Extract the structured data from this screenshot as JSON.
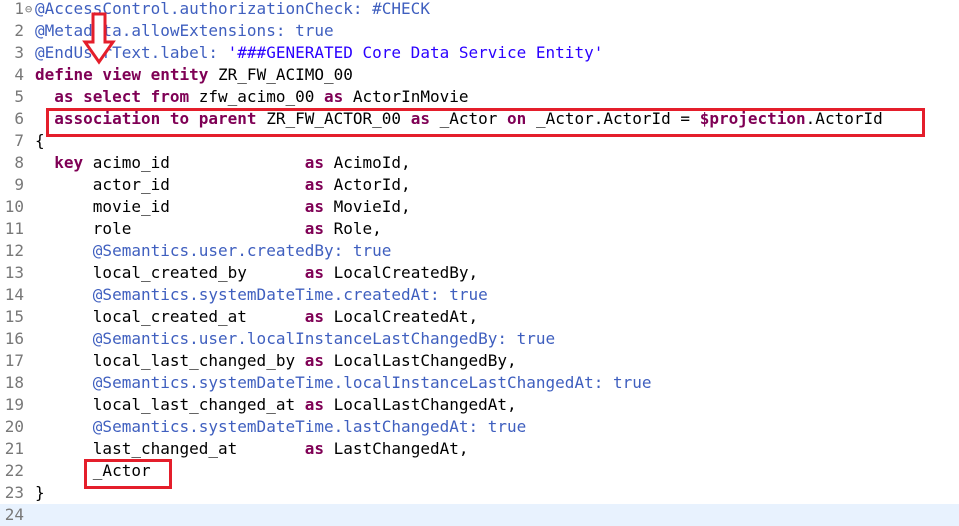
{
  "lines": [
    {
      "n": "1",
      "fold": "⊖",
      "tokens": [
        {
          "t": "ann",
          "v": "@AccessControl.authorizationCheck: #CHECK"
        }
      ]
    },
    {
      "n": "2",
      "fold": "",
      "tokens": [
        {
          "t": "ann",
          "v": "@Metadata.allowExtensions: true"
        }
      ]
    },
    {
      "n": "3",
      "fold": "",
      "tokens": [
        {
          "t": "ann",
          "v": "@EndUserText.label: "
        },
        {
          "t": "str",
          "v": "'###GENERATED Core Data Service Entity'"
        }
      ]
    },
    {
      "n": "4",
      "fold": "",
      "tokens": [
        {
          "t": "kw",
          "v": "define view entity "
        },
        {
          "t": "txt",
          "v": "ZR_FW_ACIMO_00"
        }
      ]
    },
    {
      "n": "5",
      "fold": "",
      "tokens": [
        {
          "t": "txt",
          "v": "  "
        },
        {
          "t": "kw",
          "v": "as select from "
        },
        {
          "t": "txt",
          "v": "zfw_acimo_00 "
        },
        {
          "t": "kw",
          "v": "as "
        },
        {
          "t": "txt",
          "v": "ActorInMovie"
        }
      ]
    },
    {
      "n": "6",
      "fold": "",
      "tokens": [
        {
          "t": "txt",
          "v": "  "
        },
        {
          "t": "kw",
          "v": "association to parent "
        },
        {
          "t": "txt",
          "v": "ZR_FW_ACTOR_00 "
        },
        {
          "t": "kw",
          "v": "as "
        },
        {
          "t": "txt",
          "v": "_Actor "
        },
        {
          "t": "kw",
          "v": "on "
        },
        {
          "t": "txt",
          "v": "_Actor.ActorId = "
        },
        {
          "t": "kw",
          "v": "$projection"
        },
        {
          "t": "txt",
          "v": ".ActorId"
        }
      ]
    },
    {
      "n": "7",
      "fold": "",
      "tokens": [
        {
          "t": "txt",
          "v": "{"
        }
      ]
    },
    {
      "n": "8",
      "fold": "",
      "tokens": [
        {
          "t": "txt",
          "v": "  "
        },
        {
          "t": "kw",
          "v": "key "
        },
        {
          "t": "txt",
          "v": "acimo_id              "
        },
        {
          "t": "kw",
          "v": "as "
        },
        {
          "t": "txt",
          "v": "AcimoId,"
        }
      ]
    },
    {
      "n": "9",
      "fold": "",
      "tokens": [
        {
          "t": "txt",
          "v": "      actor_id              "
        },
        {
          "t": "kw",
          "v": "as "
        },
        {
          "t": "txt",
          "v": "ActorId,"
        }
      ]
    },
    {
      "n": "10",
      "fold": "",
      "tokens": [
        {
          "t": "txt",
          "v": "      movie_id              "
        },
        {
          "t": "kw",
          "v": "as "
        },
        {
          "t": "txt",
          "v": "MovieId,"
        }
      ]
    },
    {
      "n": "11",
      "fold": "",
      "tokens": [
        {
          "t": "txt",
          "v": "      role                  "
        },
        {
          "t": "kw",
          "v": "as "
        },
        {
          "t": "txt",
          "v": "Role,"
        }
      ]
    },
    {
      "n": "12",
      "fold": "",
      "tokens": [
        {
          "t": "txt",
          "v": "      "
        },
        {
          "t": "ann",
          "v": "@Semantics.user.createdBy: true"
        }
      ]
    },
    {
      "n": "13",
      "fold": "",
      "tokens": [
        {
          "t": "txt",
          "v": "      local_created_by      "
        },
        {
          "t": "kw",
          "v": "as "
        },
        {
          "t": "txt",
          "v": "LocalCreatedBy,"
        }
      ]
    },
    {
      "n": "14",
      "fold": "",
      "tokens": [
        {
          "t": "txt",
          "v": "      "
        },
        {
          "t": "ann",
          "v": "@Semantics.systemDateTime.createdAt: true"
        }
      ]
    },
    {
      "n": "15",
      "fold": "",
      "tokens": [
        {
          "t": "txt",
          "v": "      local_created_at      "
        },
        {
          "t": "kw",
          "v": "as "
        },
        {
          "t": "txt",
          "v": "LocalCreatedAt,"
        }
      ]
    },
    {
      "n": "16",
      "fold": "",
      "tokens": [
        {
          "t": "txt",
          "v": "      "
        },
        {
          "t": "ann",
          "v": "@Semantics.user.localInstanceLastChangedBy: true"
        }
      ]
    },
    {
      "n": "17",
      "fold": "",
      "tokens": [
        {
          "t": "txt",
          "v": "      local_last_changed_by "
        },
        {
          "t": "kw",
          "v": "as "
        },
        {
          "t": "txt",
          "v": "LocalLastChangedBy,"
        }
      ]
    },
    {
      "n": "18",
      "fold": "",
      "tokens": [
        {
          "t": "txt",
          "v": "      "
        },
        {
          "t": "ann",
          "v": "@Semantics.systemDateTime.localInstanceLastChangedAt: true"
        }
      ]
    },
    {
      "n": "19",
      "fold": "",
      "tokens": [
        {
          "t": "txt",
          "v": "      local_last_changed_at "
        },
        {
          "t": "kw",
          "v": "as "
        },
        {
          "t": "txt",
          "v": "LocalLastChangedAt,"
        }
      ]
    },
    {
      "n": "20",
      "fold": "",
      "tokens": [
        {
          "t": "txt",
          "v": "      "
        },
        {
          "t": "ann",
          "v": "@Semantics.systemDateTime.lastChangedAt: true"
        }
      ]
    },
    {
      "n": "21",
      "fold": "",
      "tokens": [
        {
          "t": "txt",
          "v": "      last_changed_at       "
        },
        {
          "t": "kw",
          "v": "as "
        },
        {
          "t": "txt",
          "v": "LastChangedAt,"
        }
      ]
    },
    {
      "n": "22",
      "fold": "",
      "tokens": [
        {
          "t": "txt",
          "v": "      _Actor"
        }
      ]
    },
    {
      "n": "23",
      "fold": "",
      "tokens": [
        {
          "t": "txt",
          "v": "}"
        }
      ]
    },
    {
      "n": "24",
      "fold": "",
      "tokens": []
    }
  ],
  "colors": {
    "annotation": "#3f5fbf",
    "keyword": "#7f0055",
    "string": "#2a00ff",
    "highlight_box": "#e41e2b",
    "current_line": "#e8f2fe"
  },
  "icons": {
    "arrow": "down-arrow-icon",
    "fold": "collapse-icon"
  }
}
